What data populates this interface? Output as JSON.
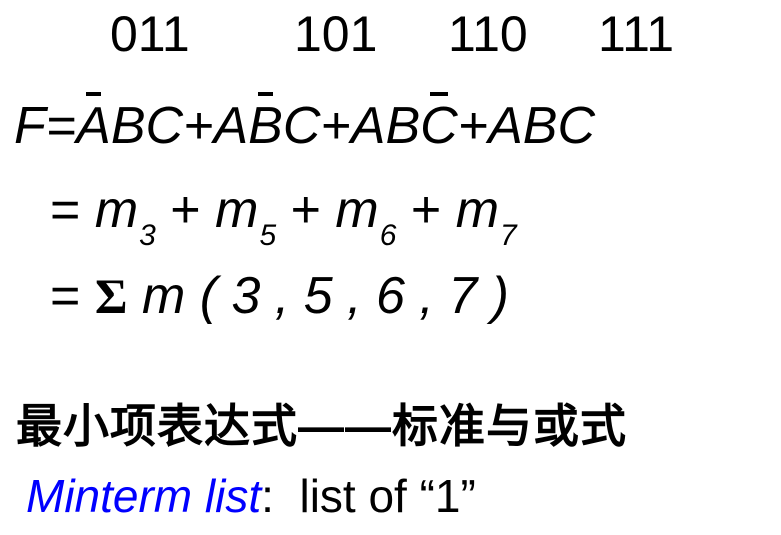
{
  "codes": [
    "011",
    "101",
    "110",
    "111"
  ],
  "function_line": {
    "lhs": "F=",
    "terms": [
      [
        {
          "t": "A",
          "bar": true
        },
        {
          "t": "BC",
          "bar": false
        }
      ],
      [
        {
          "t": "A",
          "bar": false
        },
        {
          "t": "B",
          "bar": true
        },
        {
          "t": "C",
          "bar": false
        }
      ],
      [
        {
          "t": "AB",
          "bar": false
        },
        {
          "t": "C",
          "bar": true
        }
      ],
      [
        {
          "t": "ABC",
          "bar": false
        }
      ]
    ],
    "plus": "+"
  },
  "minterm_line": {
    "eq": "=",
    "m": "m",
    "plus": "+",
    "indices": [
      "3",
      "5",
      "6",
      "7"
    ]
  },
  "sigma_line": {
    "eq": "=",
    "sigma": "Σ",
    "m": "m",
    "args": "( 3 , 5 , 6 , 7 )"
  },
  "heading": "最小项表达式——标准与或式",
  "minterm_list": {
    "label": "Minterm list",
    "colon": ":",
    "text": "list of “1”",
    "accent_color": "#0000ff"
  }
}
